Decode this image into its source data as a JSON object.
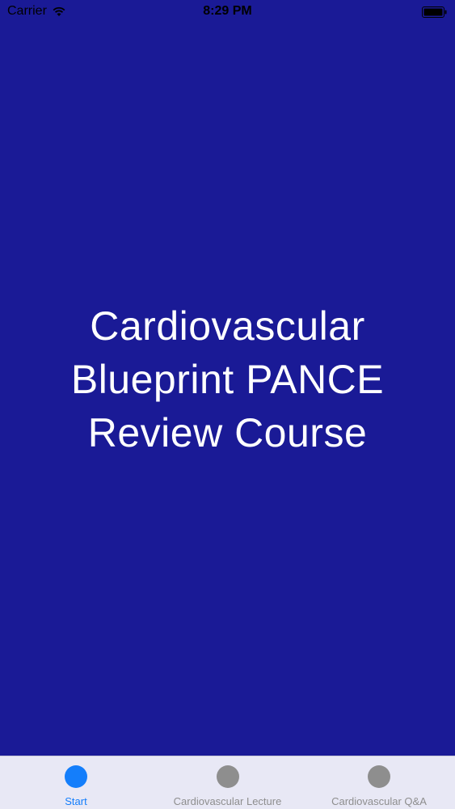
{
  "status_bar": {
    "carrier": "Carrier",
    "time": "8:29 PM",
    "icons": [
      "wifi-icon",
      "battery-icon"
    ]
  },
  "main": {
    "title_lines": [
      "Cardiovascular",
      "Blueprint PANCE",
      "Review Course"
    ],
    "background_color": "#1a1a96",
    "text_color": "#ffffff"
  },
  "tab_bar": {
    "active_color": "#147efb",
    "inactive_color": "#8e8e8e",
    "tabs": [
      {
        "label": "Start",
        "icon": "circle-icon",
        "active": true
      },
      {
        "label": "Cardiovascular Lecture",
        "icon": "circle-icon",
        "active": false
      },
      {
        "label": "Cardiovascular  Q&A",
        "icon": "circle-icon",
        "active": false
      }
    ]
  }
}
